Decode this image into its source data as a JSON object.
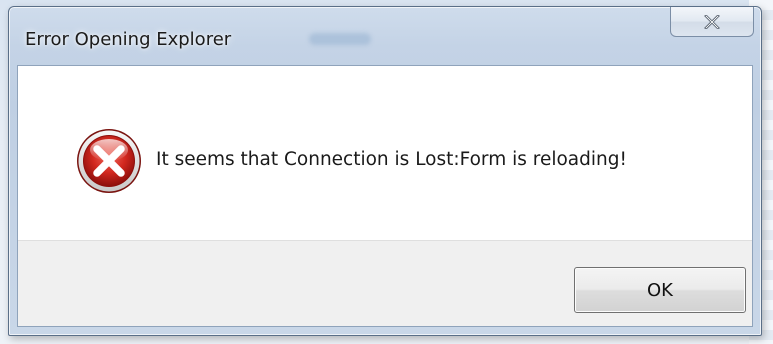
{
  "dialog": {
    "title": "Error Opening Explorer",
    "message": "It seems that Connection is Lost:Form is reloading!",
    "ok_label": "OK",
    "icon": "error-icon",
    "close_icon": "close-icon"
  },
  "colors": {
    "error_red": "#c62828",
    "footer_bg": "#f0f0f0",
    "frame": "#bfcfe3"
  }
}
